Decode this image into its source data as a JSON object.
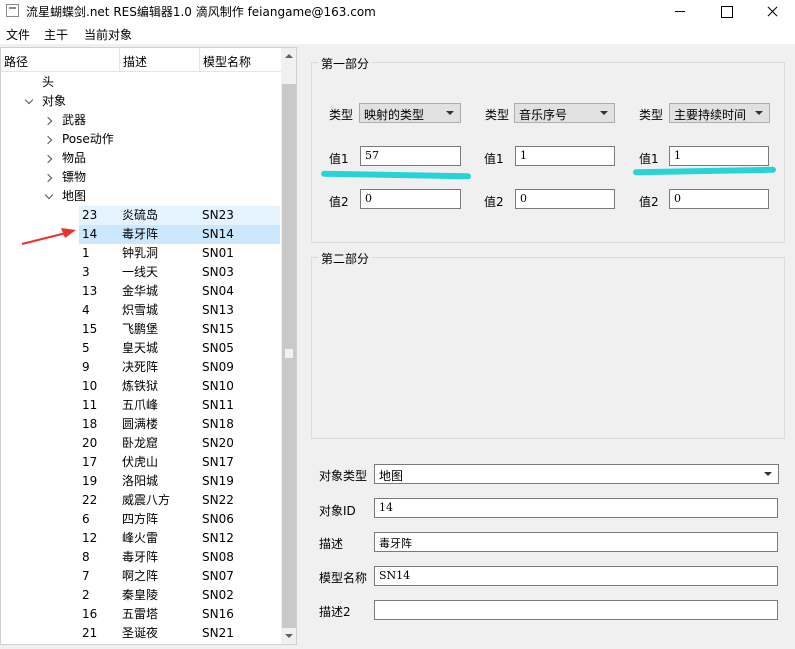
{
  "window": {
    "title": "流星蝴蝶剑.net RES编辑器1.0 滴风制作 feiangame@163.com"
  },
  "menu": [
    "文件",
    "主干",
    "当前对象"
  ],
  "tree": {
    "columns": [
      "路径",
      "描述",
      "模型名称"
    ],
    "nodes": [
      {
        "label": "头",
        "expand": "none"
      },
      {
        "label": "对象",
        "expand": "open"
      },
      {
        "label": "武器",
        "expand": "closed"
      },
      {
        "label": "Pose动作",
        "expand": "closed"
      },
      {
        "label": "物品",
        "expand": "closed"
      },
      {
        "label": "镖物",
        "expand": "closed"
      },
      {
        "label": "地图",
        "expand": "open"
      }
    ],
    "rows": [
      {
        "id": "23",
        "desc": "炎硫岛",
        "model": "SN23"
      },
      {
        "id": "14",
        "desc": "毒牙阵",
        "model": "SN14"
      },
      {
        "id": "1",
        "desc": "钟乳洞",
        "model": "SN01"
      },
      {
        "id": "3",
        "desc": "一线天",
        "model": "SN03"
      },
      {
        "id": "13",
        "desc": "金华城",
        "model": "SN04"
      },
      {
        "id": "4",
        "desc": "炽雪城",
        "model": "SN13"
      },
      {
        "id": "15",
        "desc": "飞鹏堡",
        "model": "SN15"
      },
      {
        "id": "5",
        "desc": "皇天城",
        "model": "SN05"
      },
      {
        "id": "9",
        "desc": "决死阵",
        "model": "SN09"
      },
      {
        "id": "10",
        "desc": "炼铁狱",
        "model": "SN10"
      },
      {
        "id": "11",
        "desc": "五爪峰",
        "model": "SN11"
      },
      {
        "id": "18",
        "desc": "圆满楼",
        "model": "SN18"
      },
      {
        "id": "20",
        "desc": "卧龙窟",
        "model": "SN20"
      },
      {
        "id": "17",
        "desc": "伏虎山",
        "model": "SN17"
      },
      {
        "id": "19",
        "desc": "洛阳城",
        "model": "SN19"
      },
      {
        "id": "22",
        "desc": "威震八方",
        "model": "SN22"
      },
      {
        "id": "6",
        "desc": "四方阵",
        "model": "SN06"
      },
      {
        "id": "12",
        "desc": "峰火雷",
        "model": "SN12"
      },
      {
        "id": "8",
        "desc": "毒牙阵",
        "model": "SN08"
      },
      {
        "id": "7",
        "desc": "啊之阵",
        "model": "SN07"
      },
      {
        "id": "2",
        "desc": "秦皇陵",
        "model": "SN02"
      },
      {
        "id": "16",
        "desc": "五雷塔",
        "model": "SN16"
      },
      {
        "id": "21",
        "desc": "圣诞夜",
        "model": "SN21"
      }
    ]
  },
  "part1": {
    "title": "第一部分",
    "columns": [
      {
        "type_label": "类型",
        "type_value": "映射的类型",
        "val1_label": "值1",
        "val1": "57",
        "val2_label": "值2",
        "val2": "0"
      },
      {
        "type_label": "类型",
        "type_value": "音乐序号",
        "val1_label": "值1",
        "val1": "1",
        "val2_label": "值2",
        "val2": "0"
      },
      {
        "type_label": "类型",
        "type_value": "主要持续时间",
        "val1_label": "值1",
        "val1": "1",
        "val2_label": "值2",
        "val2": "0"
      }
    ]
  },
  "part2": {
    "title": "第二部分"
  },
  "object": {
    "type_label": "对象类型",
    "type_value": "地图",
    "id_label": "对象ID",
    "id_value": "14",
    "desc_label": "描述",
    "desc_value": "毒牙阵",
    "model_label": "模型名称",
    "model_value": "SN14",
    "desc2_label": "描述2",
    "desc2_value": ""
  },
  "colors": {
    "highlight_selected": "#cce8ff",
    "highlight_hover": "#e5f3ff",
    "annotation_underline": "#26d4d8",
    "annotation_arrow": "#e8322b"
  },
  "icons": [
    "app-icon",
    "minimize-icon",
    "maximize-icon",
    "close-icon",
    "chevron-right-icon",
    "chevron-down-icon",
    "scroll-up-icon",
    "scroll-down-icon",
    "annotation-arrow-icon"
  ]
}
